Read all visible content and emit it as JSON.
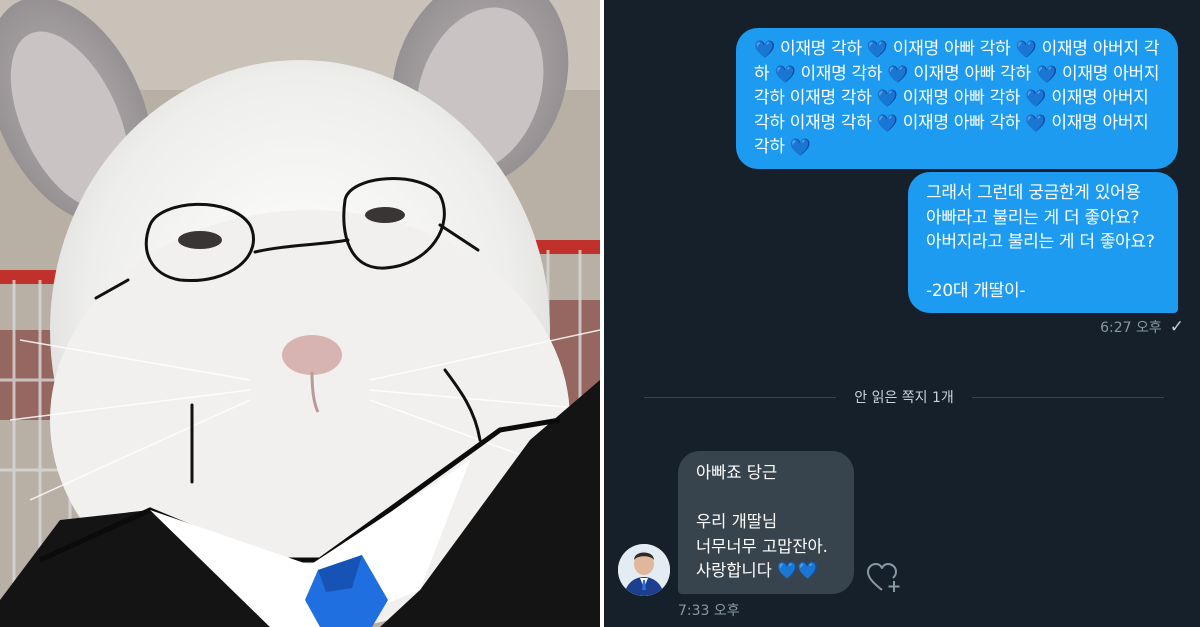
{
  "photo": {
    "subject": "chinchilla-in-suit-with-drawn-glasses",
    "colors": {
      "fur": "#f2f2f0",
      "suit": "#141414",
      "shirt": "#ffffff",
      "tie": "#1f6fe0",
      "cage": "#c0312b"
    }
  },
  "chat": {
    "background": "#15202b",
    "outgoing_color": "#1d9bf0",
    "incoming_color": "#38444d",
    "heart_glyph": "💙",
    "message1": [
      {
        "heart": true,
        "text": "이재명 각하"
      },
      {
        "heart": true,
        "text": "이재명 아빠 각하"
      },
      {
        "heart": true,
        "text": "이재명 아버지 각하"
      },
      {
        "heart": true,
        "text": "이재명 각하"
      },
      {
        "heart": true,
        "text": "이재명 아빠 각하"
      },
      {
        "heart": true,
        "text": "이재명 아버지 각하 이재명 각하"
      },
      {
        "heart": true,
        "text": "이재명 아빠 각하"
      },
      {
        "heart": true,
        "text": "이재명 아버지 각하 이재명 각하"
      },
      {
        "heart": true,
        "text": "이재명 아빠 각하"
      },
      {
        "heart": true,
        "text": "이재명 아버지 각하"
      },
      {
        "heart": true,
        "text": ""
      }
    ],
    "message2": {
      "line1": "그래서 그런데 궁금한게 있어용",
      "line2": "아빠라고 불리는 게 더 좋아요?",
      "line3": "아버지라고 불리는 게 더 좋아요?",
      "line4": "-20대 개딸이-"
    },
    "sent_time": "6:27 오후",
    "sent_status_icon": "check-icon",
    "unread_divider": "안 읽은 쪽지 1개",
    "reply": {
      "line1": "아빠죠 당근",
      "line2": "우리 개딸님",
      "line3": "너무너무 고맙잔아.",
      "line4": "사랑합니다 💙💙"
    },
    "reply_time": "7:33 오후",
    "reaction_icon": "heart-plus-icon",
    "avatar_icon": "avatar"
  }
}
